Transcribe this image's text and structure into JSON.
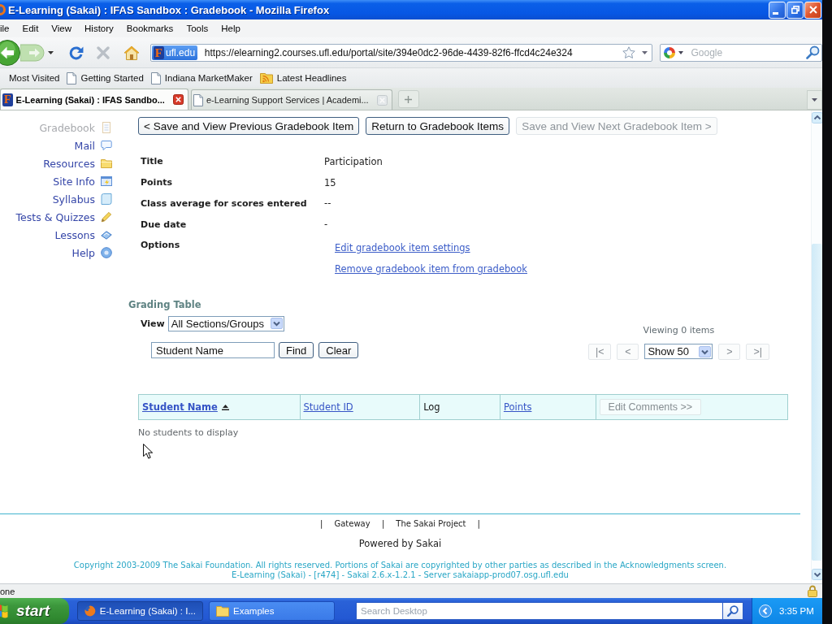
{
  "window": {
    "title": "E-Learning (Sakai) : IFAS Sandbox : Gradebook - Mozilla Firefox"
  },
  "menu_bar": [
    "ile",
    "Edit",
    "View",
    "History",
    "Bookmarks",
    "Tools",
    "Help"
  ],
  "navigation_toolbar": {
    "site_identity": {
      "logo": "F",
      "label": "ufl.edu"
    },
    "url": "https://elearning2.courses.ufl.edu/portal/site/394e0dc2-96de-4439-82f6-ffcd4c24e324",
    "search": {
      "placeholder": "Google"
    }
  },
  "bookmarks_bar": [
    {
      "label": "Most Visited",
      "kind": "clipped"
    },
    {
      "label": "Getting Started",
      "kind": "page"
    },
    {
      "label": "Indiana MarketMaker",
      "kind": "page"
    },
    {
      "label": "Latest Headlines",
      "kind": "feed"
    }
  ],
  "tabs": [
    {
      "label": "E-Learning (Sakai) : IFAS Sandbo...",
      "selected": true,
      "kind": "logo",
      "logo": "F"
    },
    {
      "label": "e-Learning Support Services | Academi...",
      "selected": false,
      "kind": "page"
    }
  ],
  "sidebar": {
    "items": [
      {
        "label": "Gradebook",
        "selected": true
      },
      {
        "label": "Mail",
        "selected": false
      },
      {
        "label": "Resources",
        "selected": false
      },
      {
        "label": "Site Info",
        "selected": false
      },
      {
        "label": "Syllabus",
        "selected": false
      },
      {
        "label": "Tests & Quizzes",
        "selected": false
      },
      {
        "label": "Lessons",
        "selected": false
      },
      {
        "label": "Help",
        "selected": false
      }
    ]
  },
  "page_buttons": [
    {
      "label": "< Save and View Previous Gradebook Item",
      "disabled": false
    },
    {
      "label": "Return to Gradebook Items",
      "disabled": false
    },
    {
      "label": "Save and View Next Gradebook Item >",
      "disabled": true
    }
  ],
  "details": [
    {
      "label": "Title",
      "value": "Participation"
    },
    {
      "label": "Points",
      "value": "15"
    },
    {
      "label": "Class average for scores entered",
      "value": "--"
    },
    {
      "label": "Due date",
      "value": "-"
    }
  ],
  "options": {
    "label": "Options",
    "links": [
      "Edit gradebook item settings",
      "Remove gradebook item from gradebook"
    ]
  },
  "grading_table": {
    "heading": "Grading Table",
    "view": {
      "label": "View",
      "value": "All Sections/Groups"
    },
    "search": {
      "value": "Student Name"
    },
    "buttons": [
      "Find",
      "Clear"
    ],
    "viewing": "Viewing 0 items",
    "pager": {
      "items": [
        {
          "kind": "button",
          "label": "|<",
          "disabled": true
        },
        {
          "kind": "button",
          "label": "<",
          "disabled": true
        },
        {
          "kind": "select",
          "label": "Show 50",
          "disabled": false
        },
        {
          "kind": "button",
          "label": ">",
          "disabled": true
        },
        {
          "kind": "button",
          "label": ">|",
          "disabled": true
        }
      ]
    },
    "columns": [
      {
        "label": "Student Name",
        "kind": "link",
        "sorted": true,
        "disabled": false
      },
      {
        "label": "Student ID",
        "kind": "link",
        "sorted": false,
        "disabled": false
      },
      {
        "label": "Log",
        "kind": "text",
        "sorted": false,
        "disabled": false
      },
      {
        "label": "Points",
        "kind": "link",
        "sorted": false,
        "disabled": false
      },
      {
        "label": "Edit Comments >>",
        "kind": "button",
        "sorted": false,
        "disabled": true
      }
    ],
    "empty_message": "No students to display"
  },
  "footer": {
    "nav": [
      {
        "kind": "separator",
        "text": "|"
      },
      {
        "kind": "link",
        "text": "Gateway"
      },
      {
        "kind": "separator",
        "text": "|"
      },
      {
        "kind": "link",
        "text": "The Sakai Project"
      },
      {
        "kind": "separator",
        "text": "|"
      }
    ],
    "powered_by": "Powered by Sakai",
    "copyright": [
      "Copyright 2003-2009 The Sakai Foundation. All rights reserved. Portions of Sakai are copyrighted by other parties as described in the Acknowledgments screen.",
      "E-Learning (Sakai) - [r474] - Sakai 2.6.x-1.2.1 - Server sakaiapp-prod07.osg.ufl.edu"
    ]
  },
  "status_bar": {
    "text": "one"
  },
  "taskbar": {
    "start": "start",
    "tasks": [
      {
        "label": "E-Learning (Sakai) : I...",
        "selected": true
      },
      {
        "label": "Examples",
        "selected": false
      }
    ],
    "search": {
      "placeholder": "Search Desktop"
    },
    "clock": "3:35 PM"
  }
}
